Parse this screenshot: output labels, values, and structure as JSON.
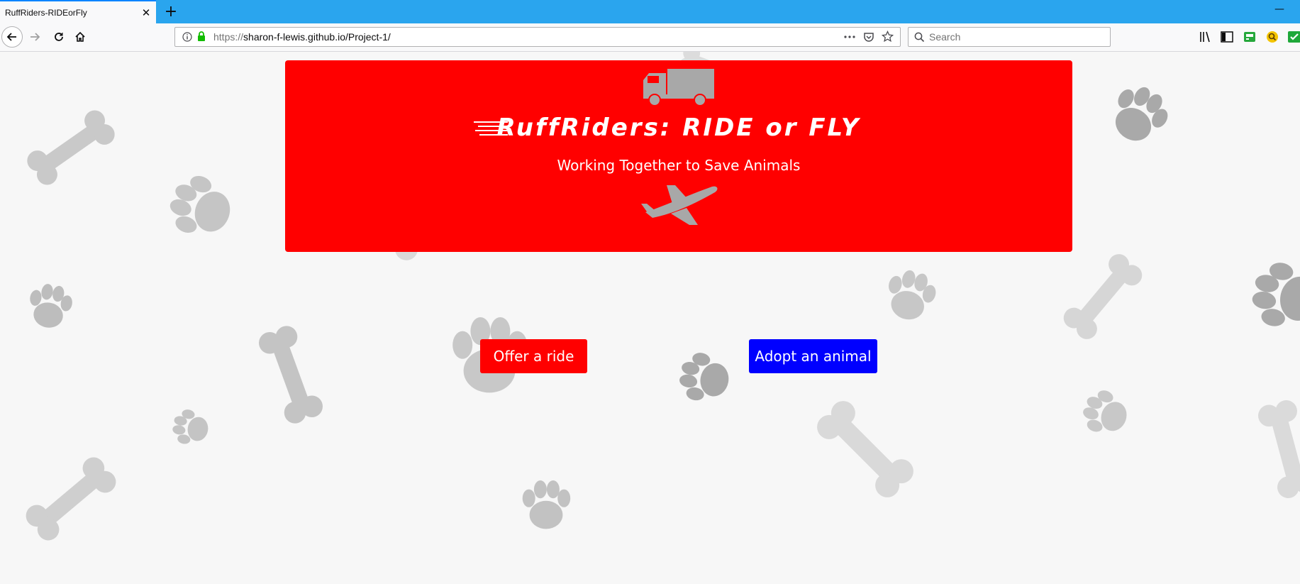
{
  "browser": {
    "tab_title": "RuffRiders-RIDEorFly",
    "url_scheme": "https://",
    "url_rest": "sharon-f-lewis.github.io/Project-1/",
    "search_placeholder": "Search",
    "new_tab_glyph": "+",
    "close_glyph": "✕",
    "minimize_glyph": "—"
  },
  "hero": {
    "title": "RuffRiders: RIDE or FLY",
    "subtitle": "Working Together to Save Animals",
    "icons": [
      "truck-icon",
      "plane-icon"
    ],
    "background_color": "#ff0000"
  },
  "actions": {
    "offer_ride": "Offer a ride",
    "adopt_animal": "Adopt an animal",
    "offer_color": "#ff0000",
    "adopt_color": "#0000ff"
  },
  "background": {
    "pattern": "paw-and-bone",
    "shapes": [
      "paw-print-icon",
      "bone-icon"
    ]
  }
}
